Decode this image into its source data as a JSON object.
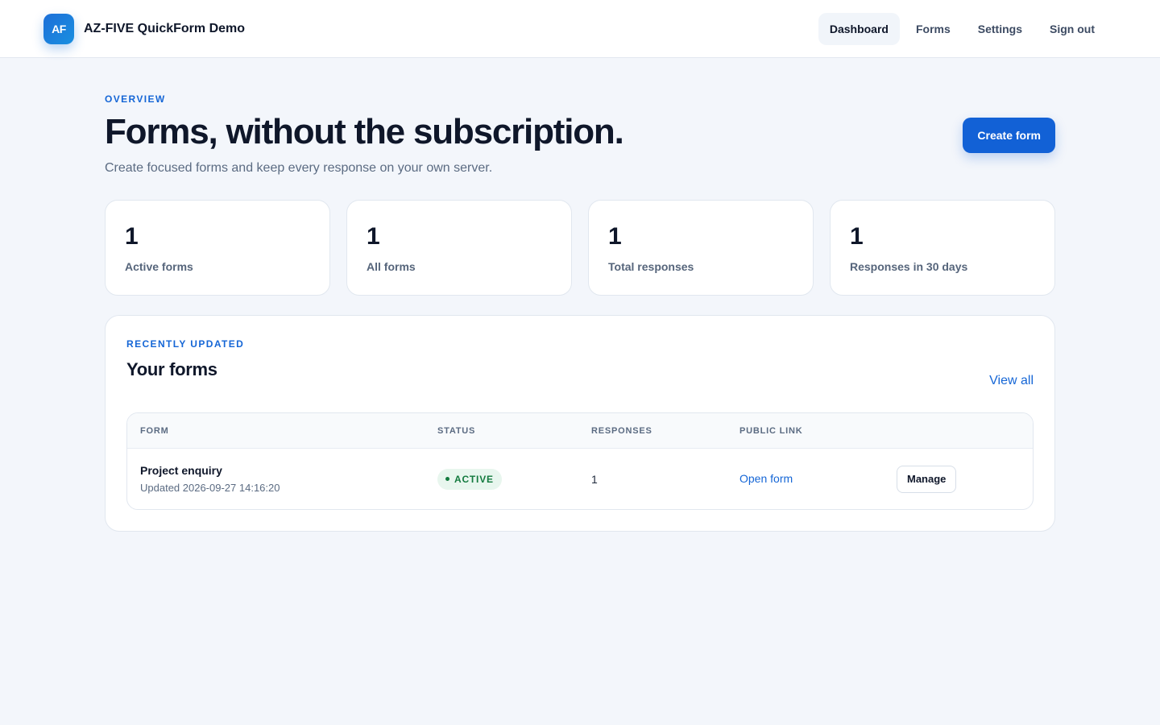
{
  "brand": {
    "logo_text": "AF",
    "name": "AZ-FIVE QuickForm Demo"
  },
  "nav": {
    "dashboard": "Dashboard",
    "forms": "Forms",
    "settings": "Settings",
    "sign_out": "Sign out",
    "active": "Dashboard"
  },
  "hero": {
    "eyebrow": "OVERVIEW",
    "title": "Forms, without the subscription.",
    "subtitle": "Create focused forms and keep every response on your own server.",
    "cta": "Create form"
  },
  "stats": [
    {
      "value": "1",
      "label": "Active forms"
    },
    {
      "value": "1",
      "label": "All forms"
    },
    {
      "value": "1",
      "label": "Total responses"
    },
    {
      "value": "1",
      "label": "Responses in 30 days"
    }
  ],
  "panel": {
    "eyebrow": "RECENTLY UPDATED",
    "title": "Your forms",
    "view_all": "View all",
    "columns": [
      "FORM",
      "STATUS",
      "RESPONSES",
      "PUBLIC LINK"
    ],
    "rows": [
      {
        "name": "Project enquiry",
        "updated": "Updated 2026-09-27 14:16:20",
        "status": "ACTIVE",
        "responses": "1",
        "link": "Open form",
        "action": "Manage"
      }
    ]
  },
  "colors": {
    "accent": "#1261d6",
    "background": "#f3f6fb",
    "active_badge_bg": "#e8f6ee",
    "active_badge_text": "#137a3e"
  }
}
